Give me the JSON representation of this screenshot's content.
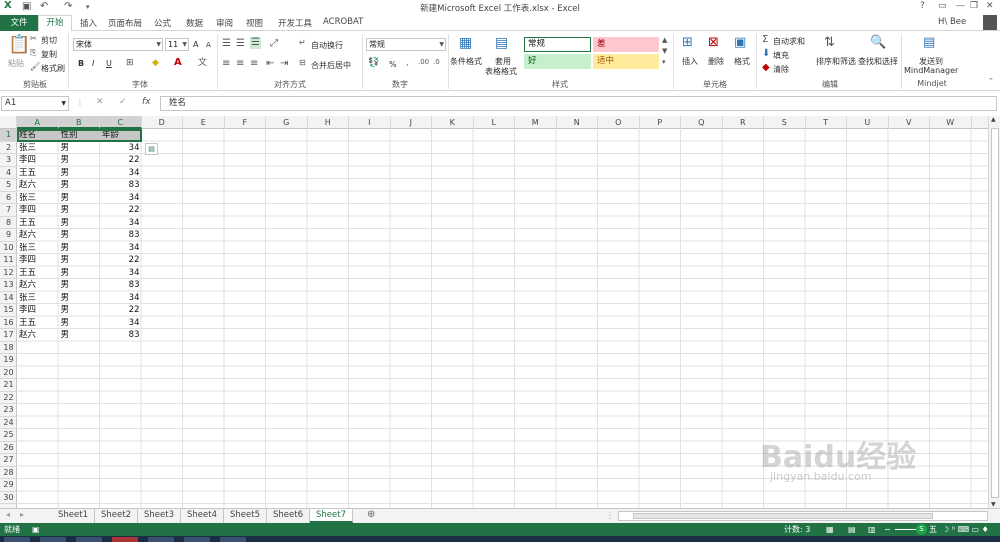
{
  "window": {
    "title": "新建Microsoft Excel 工作表.xlsx - Excel",
    "help": "?",
    "user": "H\\ Bee"
  },
  "tabs": [
    "文件",
    "开始",
    "插入",
    "页面布局",
    "公式",
    "数据",
    "审阅",
    "视图",
    "开发工具",
    "ACROBAT"
  ],
  "ribbon": {
    "clipboard": {
      "paste": "粘贴",
      "cut": "剪切",
      "copy": "复制",
      "format_painter": "格式刷",
      "label": "剪贴板"
    },
    "font": {
      "name": "宋体",
      "size": "11",
      "grow": "A",
      "shrink": "A",
      "bold": "B",
      "italic": "I",
      "underline": "U",
      "label": "字体"
    },
    "alignment": {
      "wrap": "自动换行",
      "merge": "合并后居中",
      "label": "对齐方式"
    },
    "number": {
      "format": "常规",
      "percent": "%",
      "label": "数字"
    },
    "styles": {
      "conditional": "条件格式",
      "table_line1": "套用",
      "table_line2": "表格格式",
      "normal": "常规",
      "bad": "差",
      "good": "好",
      "neutral": "适中",
      "label": "样式",
      "colors": {
        "normal_border": "#217346",
        "bad_bg": "#ffc7ce",
        "bad_fg": "#9c0006",
        "good_bg": "#c6efce",
        "good_fg": "#006100",
        "neutral_bg": "#ffeb9c",
        "neutral_fg": "#9c5700"
      }
    },
    "cells": {
      "insert": "插入",
      "delete": "删除",
      "format": "格式",
      "label": "单元格"
    },
    "editing": {
      "autosum": "自动求和",
      "fill": "填充",
      "clear": "清除",
      "sort": "排序和筛选",
      "find": "查找和选择",
      "label": "编辑"
    },
    "mindjet": {
      "send1": "发送到",
      "send2": "MindManager",
      "label": "Mindjet"
    }
  },
  "formula": {
    "namebox": "A1",
    "fx": "fx",
    "content": "姓名"
  },
  "columns": [
    "A",
    "B",
    "C",
    "D",
    "E",
    "F",
    "G",
    "H",
    "I",
    "J",
    "K",
    "L",
    "M",
    "N",
    "O",
    "P",
    "Q",
    "R",
    "S",
    "T",
    "U",
    "V",
    "W"
  ],
  "rows": [
    "1",
    "2",
    "3",
    "4",
    "5",
    "6",
    "7",
    "8",
    "9",
    "10",
    "11",
    "12",
    "13",
    "14",
    "15",
    "16",
    "17",
    "18",
    "19",
    "20",
    "21",
    "22",
    "23",
    "24",
    "25",
    "26",
    "27",
    "28",
    "29",
    "30"
  ],
  "table": {
    "header": [
      "姓名",
      "性别",
      "年龄"
    ],
    "data": [
      [
        "张三",
        "男",
        "34"
      ],
      [
        "李四",
        "男",
        "22"
      ],
      [
        "王五",
        "男",
        "34"
      ],
      [
        "赵六",
        "男",
        "83"
      ],
      [
        "张三",
        "男",
        "34"
      ],
      [
        "李四",
        "男",
        "22"
      ],
      [
        "王五",
        "男",
        "34"
      ],
      [
        "赵六",
        "男",
        "83"
      ],
      [
        "张三",
        "男",
        "34"
      ],
      [
        "李四",
        "男",
        "22"
      ],
      [
        "王五",
        "男",
        "34"
      ],
      [
        "赵六",
        "男",
        "83"
      ],
      [
        "张三",
        "男",
        "34"
      ],
      [
        "李四",
        "男",
        "22"
      ],
      [
        "王五",
        "男",
        "34"
      ],
      [
        "赵六",
        "男",
        "83"
      ]
    ]
  },
  "sheets": [
    "Sheet1",
    "Sheet2",
    "Sheet3",
    "Sheet4",
    "Sheet5",
    "Sheet6",
    "Sheet7"
  ],
  "active_sheet": "Sheet7",
  "status": {
    "ready": "就绪",
    "count": "计数: 3",
    "zoom_label": "五"
  },
  "accent": "#217346",
  "watermark": {
    "main": "Baidu经验",
    "sub": "jingyan.baidu.com"
  }
}
